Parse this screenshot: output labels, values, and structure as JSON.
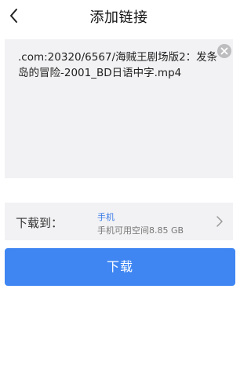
{
  "header": {
    "title": "添加链接",
    "back_icon": "chevron-left-icon"
  },
  "link": {
    "text": ".com:20320/6567/海贼王剧场版2：发条岛的冒险-2001_BD日语中字.mp4",
    "clear_icon": "close-icon"
  },
  "destination": {
    "label": "下载到：",
    "name": "手机",
    "space": "手机可用空间8.85 GB",
    "chevron_icon": "chevron-right-icon"
  },
  "download_button": {
    "label": "下载",
    "color": "#3f86f3"
  },
  "colors": {
    "accent": "#3a7ae8",
    "panel_bg": "#f2f2f4"
  }
}
